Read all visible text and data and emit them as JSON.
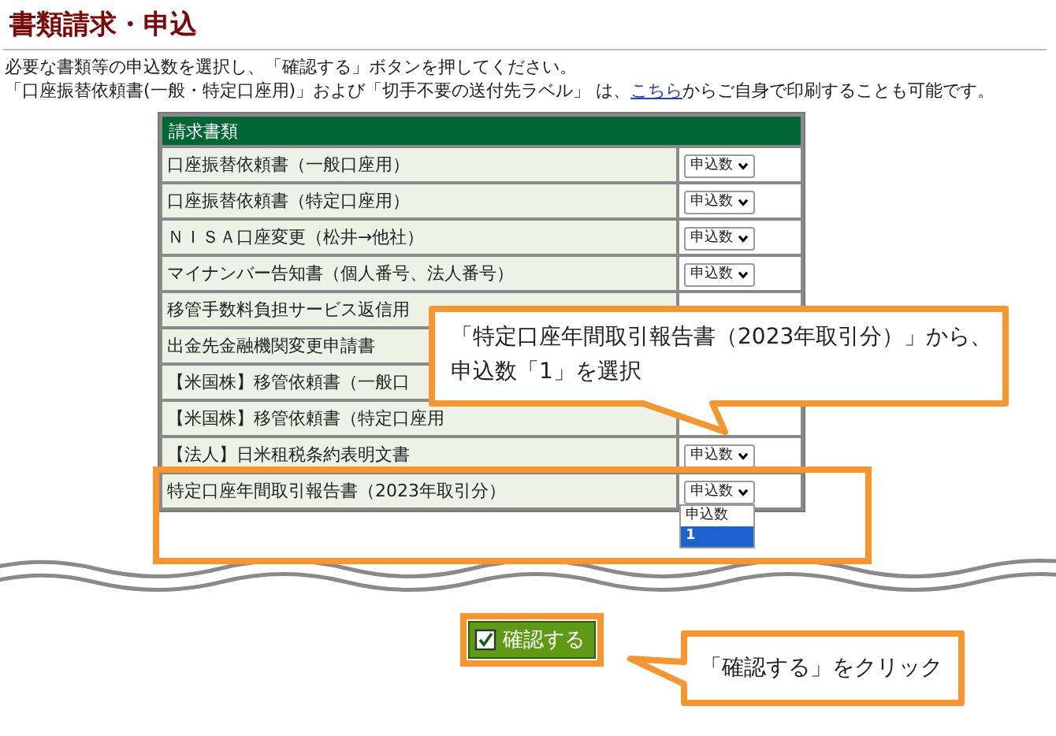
{
  "page_title": "書類請求・申込",
  "intro": {
    "line_1": "必要な書類等の申込数を選択し、「確認する」ボタンを押してください。",
    "line_2_before": "「口座振替依頼書(一般・特定口座用)」および「切手不要の送付先ラベル」 は、",
    "line_2_link": "こちら",
    "line_2_after": "からご自身で印刷することも可能です。"
  },
  "table": {
    "header": "請求書類",
    "rows": [
      {
        "label": "口座振替依頼書（一般口座用）",
        "select": "申込数"
      },
      {
        "label": "口座振替依頼書（特定口座用）",
        "select": "申込数"
      },
      {
        "label": "ＮＩＳＡ口座変更（松井→他社）",
        "select": "申込数"
      },
      {
        "label": "マイナンバー告知書（個人番号、法人番号）",
        "select": "申込数"
      },
      {
        "label": "移管手数料負担サービス返信用"
      },
      {
        "label": "出金先金融機関変更申請書"
      },
      {
        "label": "【米国株】移管依頼書（一般口"
      },
      {
        "label": "【米国株】移管依頼書（特定口座用"
      },
      {
        "label": "【法人】日米租税条約表明文書",
        "select": "申込数"
      },
      {
        "label": "特定口座年間取引報告書（2023年取引分）",
        "select": "申込数"
      }
    ]
  },
  "dropdown": {
    "options": [
      {
        "label": "申込数",
        "selected": false
      },
      {
        "label": "1",
        "selected": true
      }
    ]
  },
  "confirm_button": {
    "label": "確認する"
  },
  "callouts": [
    {
      "lines": [
        "「特定口座年間取引報告書（2023年取引分）」から、",
        "申込数「1」を選択"
      ]
    },
    {
      "lines": [
        "「確認する」をクリック"
      ]
    }
  ]
}
